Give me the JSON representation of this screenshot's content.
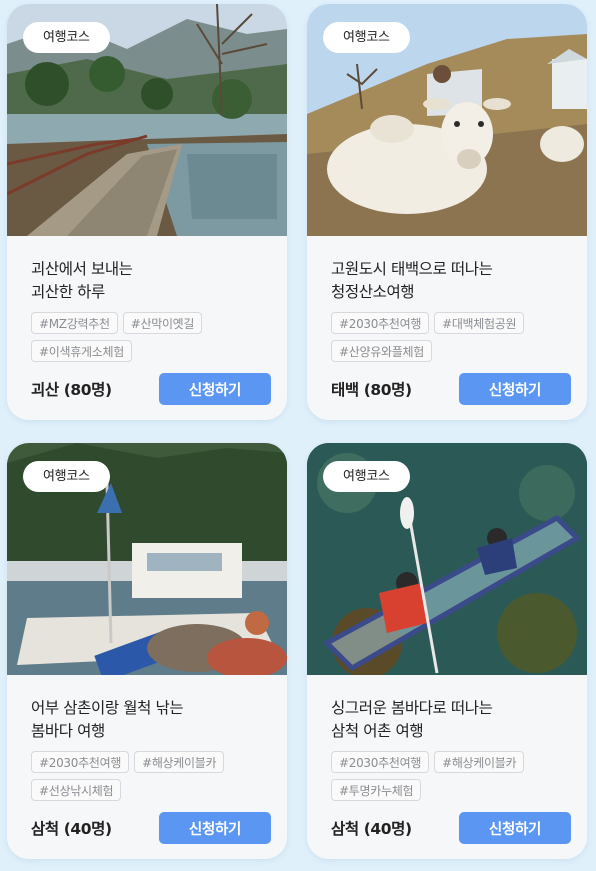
{
  "cards": [
    {
      "badge": "여행코스",
      "title_line1": "괴산에서 보내는",
      "title_line2": "괴산한 하루",
      "tags": [
        "#MZ강력추천",
        "#산막이옛길",
        "#이색휴게소체험"
      ],
      "place": "괴산 (80명)",
      "button": "신청하기",
      "image": "lake-with-stone-path-and-pine-trees"
    },
    {
      "badge": "여행코스",
      "title_line1": "고원도시 태백으로 떠나는",
      "title_line2": "청정산소여행",
      "tags": [
        "#2030추천여행",
        "#대백체험공원",
        "#산양유와플체험"
      ],
      "place": "태백 (80명)",
      "button": "신청하기",
      "image": "white-goat-on-hillside-farm"
    },
    {
      "badge": "여행코스",
      "title_line1": "어부 삼촌이랑 월척 낚는",
      "title_line2": "봄바다 여행",
      "tags": [
        "#2030추천여행",
        "#해상케이블카",
        "#선상낚시체험"
      ],
      "place": "삼척 (40명)",
      "button": "신청하기",
      "image": "fishing-boat-in-harbor"
    },
    {
      "badge": "여행코스",
      "title_line1": "싱그러운 봄바다로 떠나는",
      "title_line2": "삼척 어촌 여행",
      "tags": [
        "#2030추천여행",
        "#해상케이블카",
        "#투명카누체험"
      ],
      "place": "삼척 (40명)",
      "button": "신청하기",
      "image": "people-in-clear-canoe"
    }
  ],
  "colors": {
    "page_background": "#dff0fb",
    "button": "#5b97f2",
    "card_body": "#f6f7f9"
  }
}
